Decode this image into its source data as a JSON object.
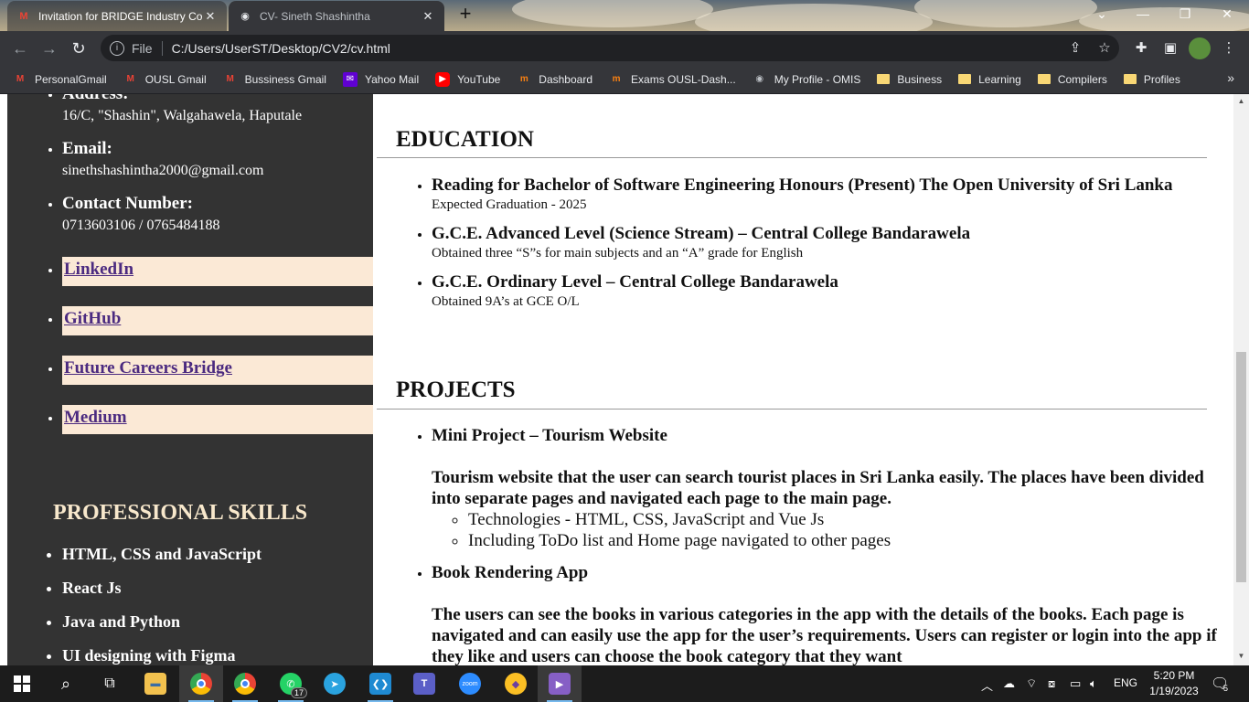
{
  "browser": {
    "tabs": [
      {
        "title": "Invitation for BRIDGE Industry Co",
        "icon": "gmail-icon",
        "active": false
      },
      {
        "title": "CV- Sineth Shashintha",
        "icon": "globe-icon",
        "active": true
      }
    ],
    "new_tab": "+",
    "window_controls": {
      "dropdown": "⌄",
      "minimize": "—",
      "restore": "❐",
      "close": "✕"
    },
    "address": {
      "scheme_label": "File",
      "url": "C:/Users/UserST/Desktop/CV2/cv.html"
    },
    "bookmarks": [
      {
        "label": "PersonalGmail",
        "icon": "gmail-icon"
      },
      {
        "label": "OUSL Gmail",
        "icon": "gmail-icon"
      },
      {
        "label": "Bussiness Gmail",
        "icon": "gmail-icon"
      },
      {
        "label": "Yahoo Mail",
        "icon": "yahoo-icon"
      },
      {
        "label": "YouTube",
        "icon": "youtube-icon"
      },
      {
        "label": "Dashboard",
        "icon": "moodle-icon"
      },
      {
        "label": "Exams OUSL-Dash...",
        "icon": "moodle-icon"
      },
      {
        "label": "My Profile - OMIS",
        "icon": "globe-icon"
      },
      {
        "label": "Business",
        "icon": "folder-icon"
      },
      {
        "label": "Learning",
        "icon": "folder-icon"
      },
      {
        "label": "Compilers",
        "icon": "folder-icon"
      },
      {
        "label": "Profiles",
        "icon": "folder-icon"
      }
    ],
    "bookmarks_more": "»"
  },
  "sidebar": {
    "contact": [
      {
        "label": "Address:",
        "value": "16/C, \"Shashin\", Walgahawela, Haputale"
      },
      {
        "label": "Email:",
        "value": "sinethshashintha2000@gmail.com"
      },
      {
        "label": "Contact Number:",
        "value": "0713603106 / 0765484188"
      }
    ],
    "links": [
      "LinkedIn",
      "GitHub",
      "Future Careers Bridge",
      "Medium"
    ],
    "skills_title": "PROFESSIONAL SKILLS",
    "skills": [
      "HTML, CSS and JavaScript",
      "React Js",
      "Java and Python",
      "UI designing with Figma"
    ]
  },
  "main": {
    "education": {
      "title": "EDUCATION",
      "items": [
        {
          "heading": "Reading for Bachelor of Software Engineering Honours (Present) The Open University of Sri Lanka",
          "sub": "Expected Graduation - 2025"
        },
        {
          "heading": "G.C.E. Advanced Level (Science Stream) – Central College Bandarawela",
          "sub": "Obtained three “S”s for main subjects and an “A” grade for English"
        },
        {
          "heading": "G.C.E. Ordinary Level – Central College Bandarawela",
          "sub": "Obtained 9A’s at GCE O/L"
        }
      ]
    },
    "projects": {
      "title": "PROJECTS",
      "items": [
        {
          "heading": "Mini Project – Tourism Website",
          "description": "Tourism website that the user can search tourist places in Sri Lanka easily. The places have been divided into separate pages and navigated each page to the main page.",
          "points": [
            "Technologies - HTML, CSS, JavaScript and Vue Js",
            "Including ToDo list and Home page navigated to other pages"
          ]
        },
        {
          "heading": "Book Rendering App",
          "description": "The users can see the books in various categories in the app with the details of the books. Each page is navigated and can easily use the app for the user’s requirements. Users can register or login into the app if they like and users can choose the book category that they want",
          "points": []
        }
      ]
    }
  },
  "taskbar": {
    "apps": [
      {
        "name": "start",
        "icon": "windows-icon"
      },
      {
        "name": "search",
        "icon": "search-icon"
      },
      {
        "name": "task-view",
        "icon": "task-view-icon"
      },
      {
        "name": "file-explorer",
        "icon": "folder-icon"
      },
      {
        "name": "chrome-profile",
        "icon": "chrome-icon"
      },
      {
        "name": "chrome",
        "icon": "chrome-icon"
      },
      {
        "name": "whatsapp",
        "icon": "whatsapp-icon",
        "badge": "17"
      },
      {
        "name": "telegram",
        "icon": "telegram-icon"
      },
      {
        "name": "vscode",
        "icon": "vscode-icon"
      },
      {
        "name": "teams",
        "icon": "teams-icon"
      },
      {
        "name": "zoom",
        "icon": "zoom-icon",
        "label": "zoom"
      },
      {
        "name": "brave",
        "icon": "brave-icon"
      },
      {
        "name": "visual-studio",
        "icon": "visual-studio-icon"
      }
    ],
    "language": "ENG",
    "time": "5:20 PM",
    "date": "1/19/2023",
    "notifications": "5"
  }
}
